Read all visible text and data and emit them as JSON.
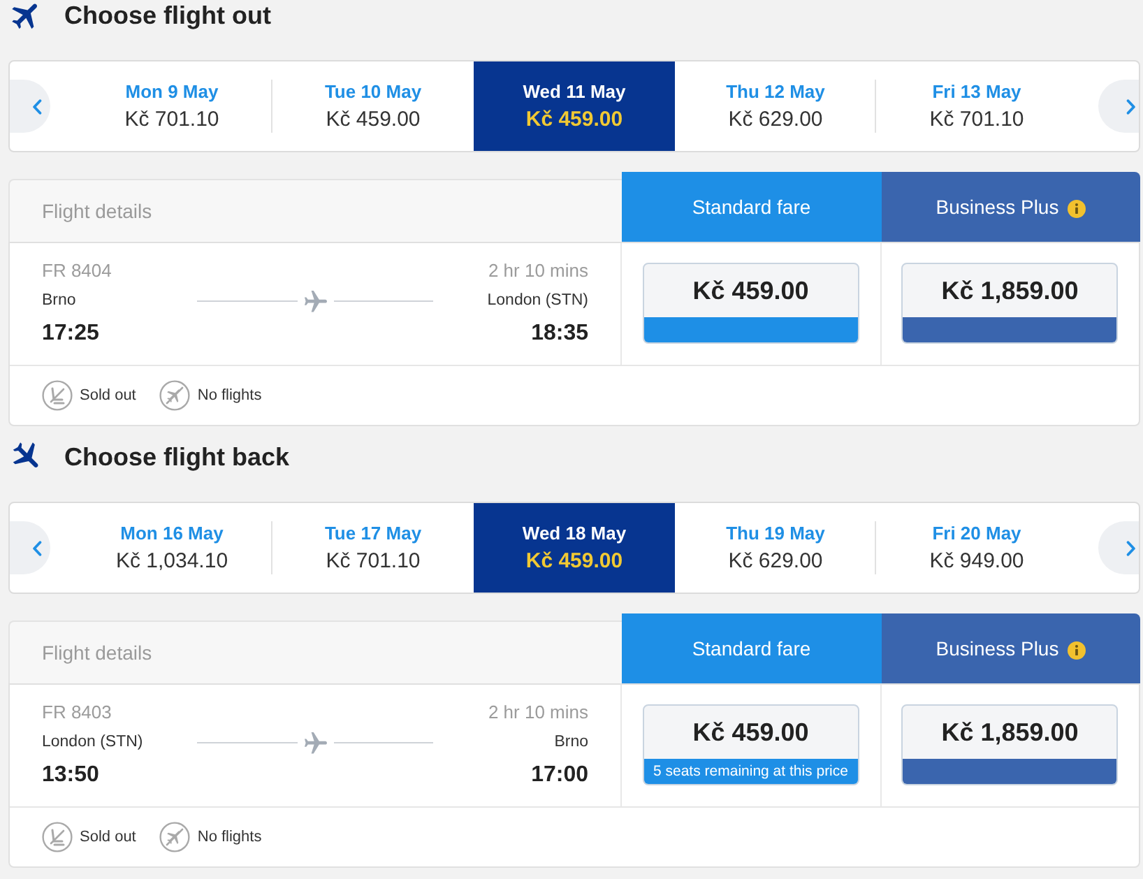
{
  "sections": [
    {
      "kind": "outbound",
      "title": "Choose flight out",
      "dates": [
        {
          "day": "Mon 9 May",
          "price": "Kč 701.10",
          "selected": false
        },
        {
          "day": "Tue 10 May",
          "price": "Kč 459.00",
          "selected": false
        },
        {
          "day": "Wed 11 May",
          "price": "Kč 459.00",
          "selected": true
        },
        {
          "day": "Thu 12 May",
          "price": "Kč 629.00",
          "selected": false
        },
        {
          "day": "Fri 13 May",
          "price": "Kč 701.10",
          "selected": false
        }
      ],
      "table": {
        "details_header": "Flight details",
        "fare_headers": [
          {
            "kind": "standard",
            "label": "Standard fare",
            "info": false
          },
          {
            "kind": "business",
            "label": "Business Plus",
            "info": true
          }
        ],
        "flight": {
          "number": "FR 8404",
          "duration": "2 hr 10 mins",
          "from": "Brno",
          "to": "London (STN)",
          "departure": "17:25",
          "arrival": "18:35"
        },
        "fares": [
          {
            "kind": "standard",
            "price": "Kč 459.00"
          },
          {
            "kind": "business",
            "price": "Kč 1,859.00"
          }
        ],
        "legend": [
          {
            "kind": "sold_out",
            "label": "Sold out"
          },
          {
            "kind": "no_flights",
            "label": "No flights"
          }
        ]
      }
    },
    {
      "kind": "return",
      "title": "Choose flight back",
      "dates": [
        {
          "day": "Mon 16 May",
          "price": "Kč 1,034.10",
          "selected": false
        },
        {
          "day": "Tue 17 May",
          "price": "Kč 701.10",
          "selected": false
        },
        {
          "day": "Wed 18 May",
          "price": "Kč 459.00",
          "selected": true
        },
        {
          "day": "Thu 19 May",
          "price": "Kč 629.00",
          "selected": false
        },
        {
          "day": "Fri 20 May",
          "price": "Kč 949.00",
          "selected": false
        }
      ],
      "table": {
        "details_header": "Flight details",
        "fare_headers": [
          {
            "kind": "standard",
            "label": "Standard fare",
            "info": false
          },
          {
            "kind": "business",
            "label": "Business Plus",
            "info": true
          }
        ],
        "flight": {
          "number": "FR 8403",
          "duration": "2 hr 10 mins",
          "from": "London (STN)",
          "to": "Brno",
          "departure": "13:50",
          "arrival": "17:00"
        },
        "fares": [
          {
            "kind": "standard",
            "price": "Kč 459.00",
            "note": "5 seats remaining at this price"
          },
          {
            "kind": "business",
            "price": "Kč 1,859.00"
          }
        ],
        "legend": [
          {
            "kind": "sold_out",
            "label": "Sold out"
          },
          {
            "kind": "no_flights",
            "label": "No flights"
          }
        ]
      }
    }
  ]
}
